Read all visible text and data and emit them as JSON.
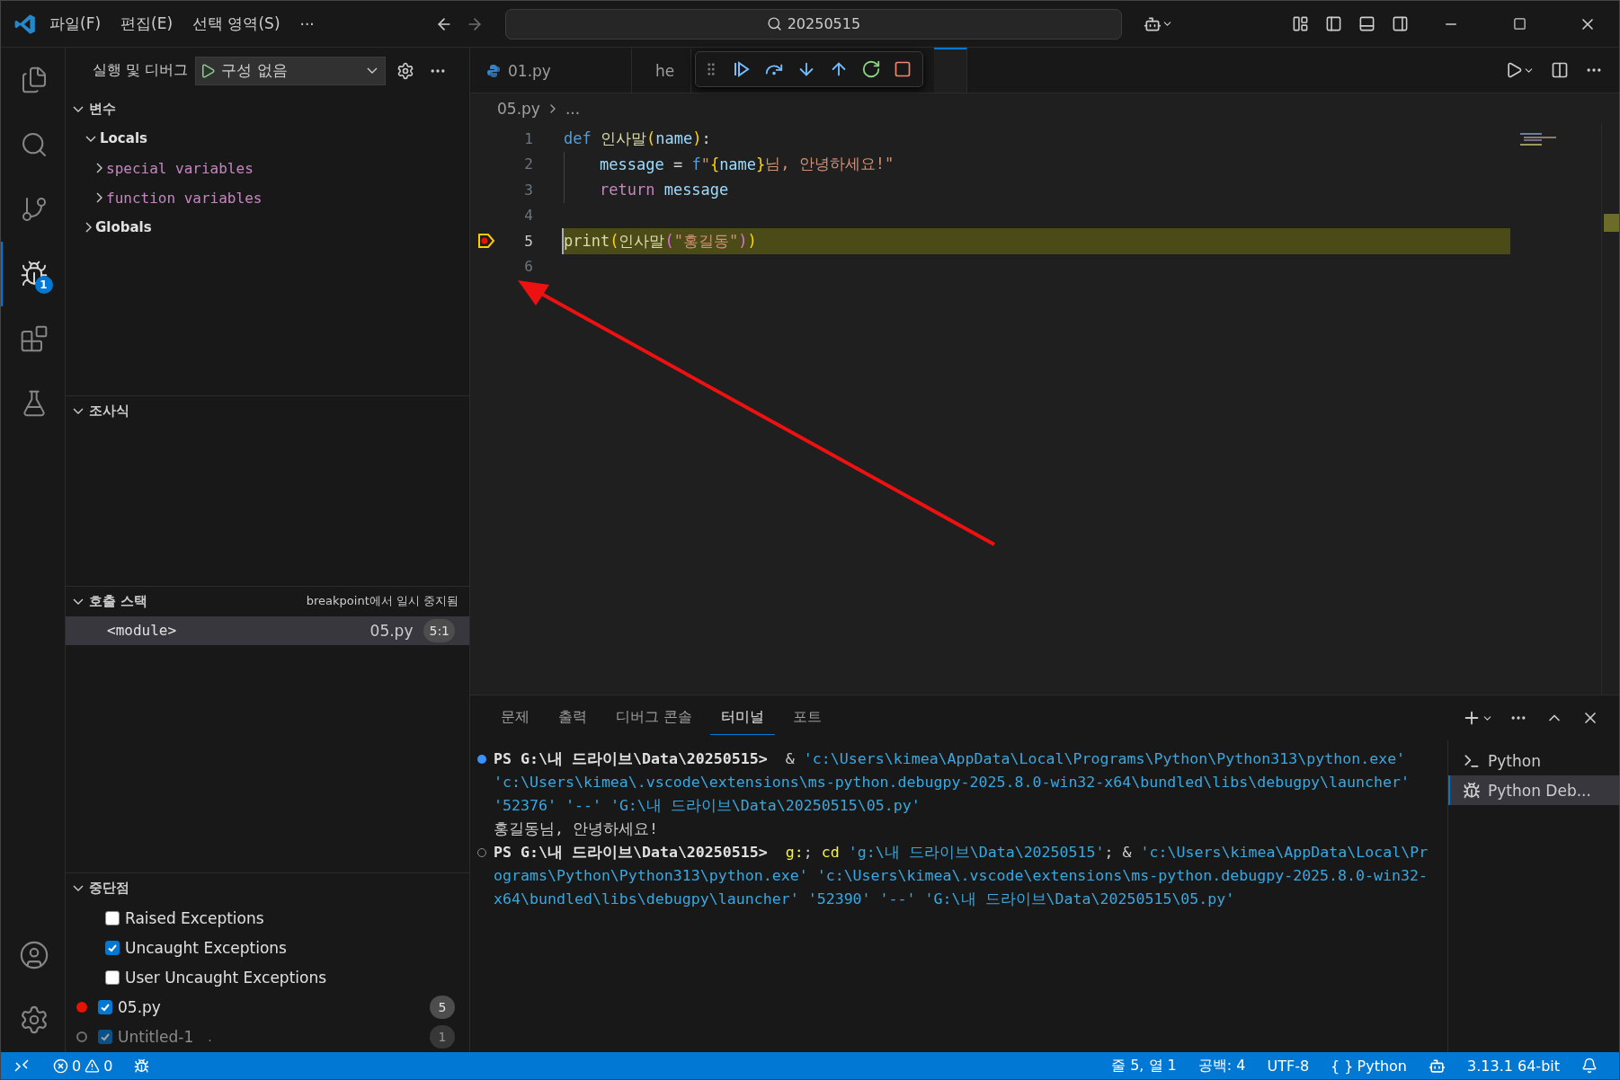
{
  "title_bar": {
    "menus": [
      "파일(F)",
      "편집(E)",
      "선택 영역(S)",
      "···"
    ],
    "search": "20250515"
  },
  "activity_bar": [
    {
      "kind": "explorer",
      "selected": false
    },
    {
      "kind": "search",
      "selected": false
    },
    {
      "kind": "scm",
      "selected": false
    },
    {
      "kind": "debug",
      "selected": true,
      "badge": "1"
    },
    {
      "kind": "extensions",
      "selected": false
    },
    {
      "kind": "testing",
      "selected": false
    }
  ],
  "sidebar": {
    "title": "실행 및 디버그",
    "config": "구성 없음",
    "variables": {
      "title": "변수",
      "expanded": true,
      "items": [
        {
          "label": "Locals",
          "expanded": true,
          "children": [
            {
              "label": "special variables",
              "expanded": false
            },
            {
              "label": "function variables",
              "expanded": false
            }
          ]
        },
        {
          "label": "Globals",
          "expanded": false
        }
      ]
    },
    "watch": {
      "title": "조사식",
      "expanded": true
    },
    "call_stack": {
      "title": "호출 스택",
      "expanded": true,
      "status": "breakpoint에서 일시 중지됨",
      "frames": [
        {
          "name": "<module>",
          "file": "05.py",
          "position": "5:1",
          "selected": true
        }
      ]
    },
    "breakpoints": {
      "title": "중단점",
      "expanded": true,
      "items": [
        {
          "kind": "exception",
          "label": "Raised Exceptions",
          "checked": false
        },
        {
          "kind": "exception",
          "label": "Uncaught Exceptions",
          "checked": true
        },
        {
          "kind": "exception",
          "label": "User Uncaught Exceptions",
          "checked": false
        },
        {
          "kind": "file",
          "label": "05.py",
          "checked": true,
          "verified": true,
          "count": "5"
        },
        {
          "kind": "file",
          "label": "Untitled-1",
          "description": ".",
          "checked": true,
          "verified": false,
          "count": "1"
        }
      ]
    }
  },
  "editor": {
    "tabs": [
      {
        "label": "01.py",
        "selected": false
      },
      {
        "label": "he",
        "selected": false
      },
      {
        "selected": true
      }
    ],
    "breadcrumb": [
      "05.py",
      "..."
    ],
    "lines": [
      {
        "number": "1",
        "current": false,
        "breakpoint": false,
        "indented": false,
        "tokens": [
          {
            "kind": "keyword",
            "text": "def "
          },
          {
            "kind": "function",
            "text": "인사말"
          },
          {
            "kind": "bracket",
            "text": "("
          },
          {
            "kind": "param",
            "text": "name"
          },
          {
            "kind": "bracket",
            "text": ")"
          },
          {
            "kind": "plain",
            "text": ":"
          }
        ]
      },
      {
        "number": "2",
        "current": false,
        "breakpoint": false,
        "indented": true,
        "tokens": [
          {
            "kind": "param",
            "text": "message"
          },
          {
            "kind": "plain",
            "text": " = "
          },
          {
            "kind": "keyword",
            "text": "f"
          },
          {
            "kind": "string",
            "text": "\""
          },
          {
            "kind": "bracket",
            "text": "{"
          },
          {
            "kind": "param",
            "text": "name"
          },
          {
            "kind": "bracket",
            "text": "}"
          },
          {
            "kind": "string",
            "text": "님, 안녕하세요!\""
          }
        ]
      },
      {
        "number": "3",
        "current": false,
        "breakpoint": false,
        "indented": true,
        "tokens": [
          {
            "kind": "control",
            "text": "return "
          },
          {
            "kind": "param",
            "text": "message"
          }
        ]
      },
      {
        "number": "4",
        "current": false,
        "breakpoint": false,
        "indented": false
      },
      {
        "number": "5",
        "current": true,
        "breakpoint": true,
        "indented": false,
        "tokens": [
          {
            "kind": "function",
            "text": "print"
          },
          {
            "kind": "bracket",
            "text": "("
          },
          {
            "kind": "function",
            "text": "인사말"
          },
          {
            "kind": "bracket2",
            "text": "("
          },
          {
            "kind": "string",
            "text": "\"홍길동\""
          },
          {
            "kind": "bracket2",
            "text": ")"
          },
          {
            "kind": "bracket",
            "text": ")"
          }
        ]
      },
      {
        "number": "6",
        "current": false,
        "breakpoint": false,
        "indented": false
      }
    ]
  },
  "panel": {
    "tabs": [
      {
        "label": "문제",
        "selected": false
      },
      {
        "label": "출력",
        "selected": false
      },
      {
        "label": "디버그 콘솔",
        "selected": false
      },
      {
        "label": "터미널",
        "selected": true
      },
      {
        "label": "포트",
        "selected": false
      }
    ],
    "terminal": [
      {
        "kind": "command",
        "succeeded": true,
        "prompt": "PS G:\\내 드라이브\\Data\\20250515>",
        "segments": [
          {
            "kind": "plain",
            "text": "& "
          },
          {
            "kind": "string",
            "text": "'c:\\Users\\kimea\\AppData\\Local\\Programs\\Python\\Python313\\python.exe' "
          },
          {
            "kind": "string",
            "text": "'c:\\Users\\kimea\\.vscode\\extensions\\ms-python.debugpy-2025.8.0-win32-x64\\bundled\\libs\\debugpy\\launcher' "
          },
          {
            "kind": "string",
            "text": "'52376' "
          },
          {
            "kind": "string",
            "text": "'--' "
          },
          {
            "kind": "string",
            "text": "'G:\\내 드라이브\\Data\\20250515\\05.py'"
          }
        ]
      },
      {
        "kind": "output",
        "text": "홍길동님, 안녕하세요!"
      },
      {
        "kind": "command",
        "succeeded": false,
        "prompt": "PS G:\\내 드라이브\\Data\\20250515>",
        "segments": [
          {
            "kind": "command",
            "text": "g:"
          },
          {
            "kind": "plain",
            "text": "; "
          },
          {
            "kind": "command",
            "text": "cd "
          },
          {
            "kind": "string",
            "text": "'g:\\내 드라이브\\Data\\20250515'"
          },
          {
            "kind": "plain",
            "text": "; & "
          },
          {
            "kind": "string",
            "text": "'c:\\Users\\kimea\\AppData\\Local\\Programs\\Python\\Python313\\python.exe' "
          },
          {
            "kind": "string",
            "text": "'c:\\Users\\kimea\\.vscode\\extensions\\ms-python.debugpy-2025.8.0-win32-x64\\bundled\\libs\\debugpy\\launcher' "
          },
          {
            "kind": "string",
            "text": "'52390' "
          },
          {
            "kind": "string",
            "text": "'--' "
          },
          {
            "kind": "string",
            "text": "'G:\\내 드라이브\\Data\\20250515\\05.py'"
          }
        ]
      }
    ],
    "sessions": [
      {
        "kind": "shell",
        "label": "Python",
        "selected": false
      },
      {
        "kind": "debug",
        "label": "Python Deb...",
        "selected": true
      }
    ]
  },
  "status_bar": {
    "errors": "0",
    "warnings": "0",
    "position": "줄 5, 열 1",
    "indent": "공백: 4",
    "encoding": "UTF-8",
    "language_icon": "{ }",
    "language": "Python",
    "interpreter": "3.13.1 64-bit"
  }
}
